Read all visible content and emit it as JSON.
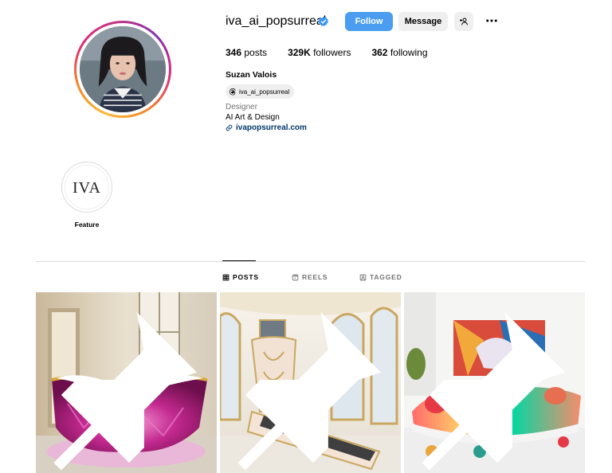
{
  "profile": {
    "username": "iva_ai_popsurreal",
    "verified": true,
    "full_name": "Suzan Valois",
    "threads_handle": "iva_ai_popsurreal",
    "category": "Designer",
    "bio": "AI Art & Design",
    "link": "ivapopsurreal.com"
  },
  "actions": {
    "follow_label": "Follow",
    "message_label": "Message",
    "add_user_icon": "add-user-icon",
    "more_icon": "more-icon"
  },
  "stats": {
    "posts_count": "346",
    "posts_label": "posts",
    "followers_count": "329K",
    "followers_label": "followers",
    "following_count": "362",
    "following_label": "following"
  },
  "highlights": [
    {
      "label": "Feature",
      "cover_text": "IVA"
    }
  ],
  "tabs": [
    {
      "label": "POSTS",
      "icon": "grid-icon",
      "active": true
    },
    {
      "label": "REELS",
      "icon": "reels-icon",
      "active": false
    },
    {
      "label": "TAGGED",
      "icon": "tagged-icon",
      "active": false
    }
  ],
  "posts": [
    {
      "subject": "pink crystal bathtub",
      "pinned": true
    },
    {
      "subject": "ornate white and gold treadmill",
      "pinned": true
    },
    {
      "subject": "skateboard sofa",
      "pinned": true
    }
  ],
  "colors": {
    "follow_button": "#4a9df0",
    "link": "#00376b",
    "secondary_button": "#efefef",
    "muted_text": "#737373",
    "verified_badge": "#3897f0"
  }
}
